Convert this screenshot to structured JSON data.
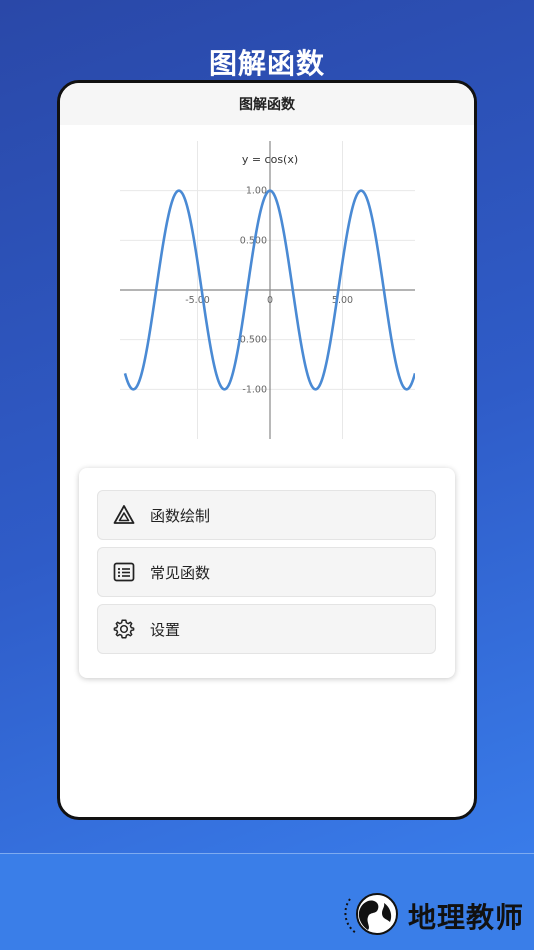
{
  "promo": {
    "title": "图解函数"
  },
  "app": {
    "title": "图解函数"
  },
  "chart_data": {
    "type": "line",
    "title": "y = cos(x)",
    "function": "cos(x)",
    "x": [
      -10,
      -9.5,
      -9,
      -8.5,
      -8,
      -7.5,
      -7,
      -6.5,
      -6,
      -5.5,
      -5,
      -4.5,
      -4,
      -3.5,
      -3,
      -2.5,
      -2,
      -1.5,
      -1,
      -0.5,
      0,
      0.5,
      1,
      1.5,
      2,
      2.5,
      3,
      3.5,
      4,
      4.5,
      5,
      5.5,
      6,
      6.5,
      7,
      7.5,
      8,
      8.5,
      9,
      9.5,
      10
    ],
    "y": [
      -0.839,
      -0.997,
      -0.911,
      -0.602,
      -0.146,
      0.347,
      0.754,
      0.977,
      0.96,
      0.709,
      0.284,
      -0.211,
      -0.654,
      -0.936,
      -0.99,
      -0.801,
      -0.416,
      0.071,
      0.54,
      0.878,
      1.0,
      0.878,
      0.54,
      0.071,
      -0.416,
      -0.801,
      -0.99,
      -0.936,
      -0.654,
      -0.211,
      0.284,
      0.709,
      0.96,
      0.977,
      0.754,
      0.347,
      -0.146,
      -0.602,
      -0.911,
      -0.997,
      -0.839
    ],
    "xlim": [
      -10,
      10
    ],
    "ylim": [
      -1.5,
      1.5
    ],
    "x_ticks": [
      {
        "value": -5,
        "label": "-5.00"
      },
      {
        "value": 0,
        "label": "0"
      },
      {
        "value": 5,
        "label": "5.00"
      }
    ],
    "y_ticks": [
      {
        "value": 1,
        "label": "1.00"
      },
      {
        "value": 0.5,
        "label": "0.500"
      },
      {
        "value": -0.5,
        "label": "-0.500"
      },
      {
        "value": -1,
        "label": "-1.00"
      }
    ],
    "grid": true,
    "line_color": "#4a8ad4"
  },
  "menu": {
    "items": [
      {
        "label": "函数绘制",
        "icon": "triangle-icon"
      },
      {
        "label": "常见函数",
        "icon": "list-icon"
      },
      {
        "label": "设置",
        "icon": "gear-icon"
      }
    ]
  },
  "watermark": {
    "text": "地理教师",
    "icon": "globe-icon"
  },
  "colors": {
    "accent": "#3b82f0",
    "line": "#4a8ad4"
  }
}
